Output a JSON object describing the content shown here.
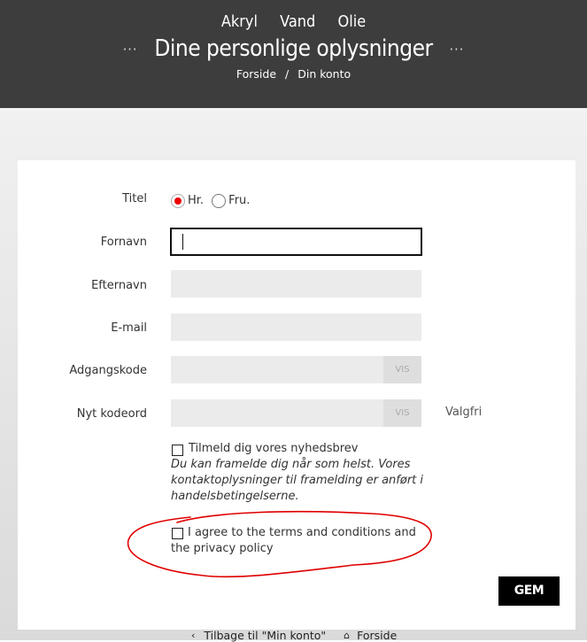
{
  "nav": {
    "items": [
      "Akryl",
      "Vand",
      "Olie"
    ]
  },
  "page_title": "Dine personlige oplysninger",
  "title_dots": "···",
  "breadcrumb": {
    "home": "Forside",
    "separator": "/",
    "current": "Din konto"
  },
  "form": {
    "title_label": "Titel",
    "title_options": [
      {
        "label": "Hr.",
        "checked": true
      },
      {
        "label": "Fru.",
        "checked": false
      }
    ],
    "firstname_label": "Fornavn",
    "firstname_value": "",
    "lastname_label": "Efternavn",
    "email_label": "E-mail",
    "password_label": "Adgangskode",
    "password_show": "VIS",
    "new_password_label": "Nyt kodeord",
    "new_password_show": "VIS",
    "new_password_optional": "Valgfri",
    "newsletter_label": "Tilmeld dig vores nyhedsbrev",
    "newsletter_hint": "Du kan framelde dig når som helst. Vores kontaktoplysninger til framelding er anført i handelsbetingelserne.",
    "terms_label": "I agree to the terms and conditions and the privacy policy",
    "save_button": "GEM"
  },
  "footer_links": {
    "back": "Tilbage til \"Min konto\"",
    "home": "Forside"
  },
  "colors": {
    "header_bg": "#3d3d3d",
    "radio_selected": "#e00000",
    "annotation": "#e00000",
    "button_bg": "#000000"
  }
}
